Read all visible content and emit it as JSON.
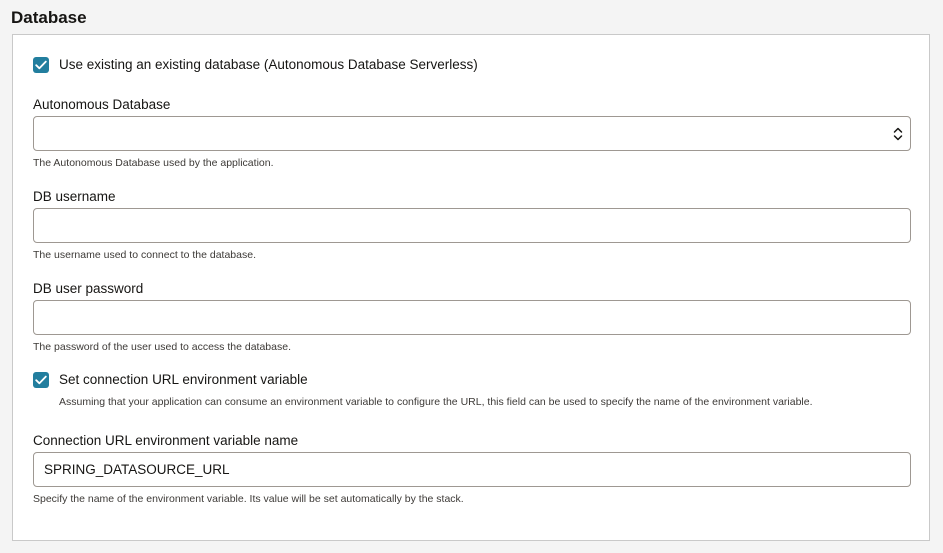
{
  "section": {
    "title": "Database"
  },
  "use_existing": {
    "checked": true,
    "label": "Use existing an existing database (Autonomous Database Serverless)"
  },
  "autonomous_db": {
    "label": "Autonomous Database",
    "value": "",
    "help": "The Autonomous Database used by the application."
  },
  "db_username": {
    "label": "DB username",
    "value": "",
    "help": "The username used to connect to the database."
  },
  "db_password": {
    "label": "DB user password",
    "value": "",
    "help": "The password of the user used to access the database."
  },
  "set_conn_url": {
    "checked": true,
    "label": "Set connection URL environment variable",
    "help": "Assuming that your application can consume an environment variable to configure the URL, this field can be used to specify the name of the environment variable."
  },
  "conn_url_name": {
    "label": "Connection URL environment variable name",
    "value": "SPRING_DATASOURCE_URL",
    "help": "Specify the name of the environment variable. Its value will be set automatically by the stack."
  },
  "colors": {
    "checkbox_accent": "#227e9e",
    "input_border": "#9e9892",
    "panel_border": "#c9c9c9",
    "page_background": "#f4f4f4"
  },
  "icons": {
    "checkbox_mark": "checkmark-icon",
    "select_indicator": "chevron-up-down-icon"
  }
}
